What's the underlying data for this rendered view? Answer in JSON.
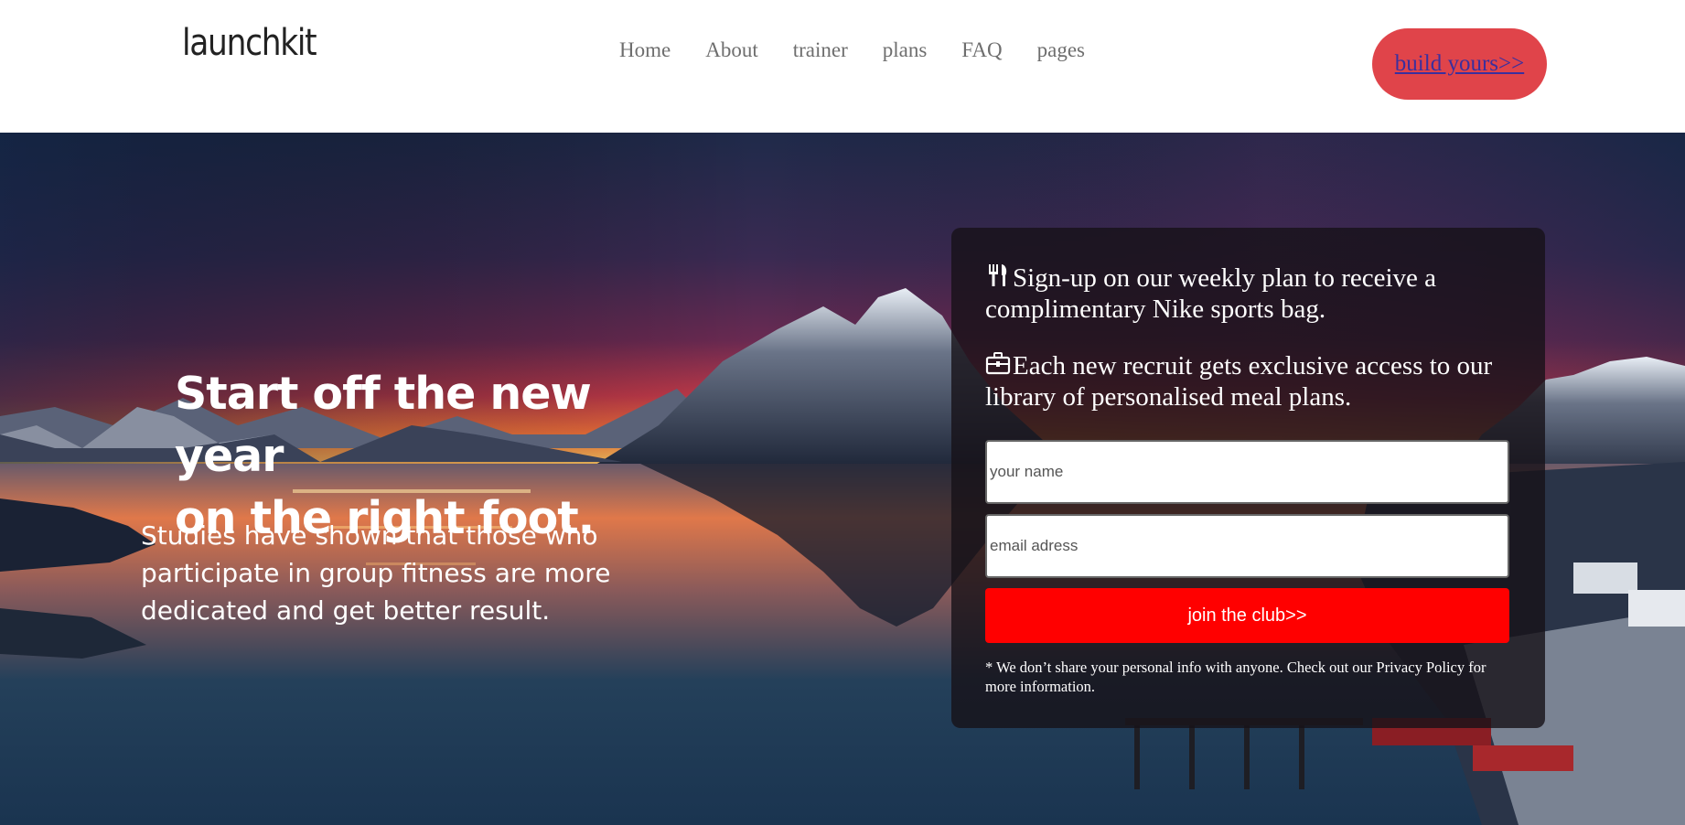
{
  "header": {
    "logo": "launchkit",
    "nav": [
      "Home",
      "About",
      "trainer",
      "plans",
      "FAQ",
      "pages"
    ],
    "cta_label": "build yours>>"
  },
  "hero": {
    "headline_line1": "Start off the new year",
    "headline_line2": "on the right foot.",
    "subtext": "Studies have shown that those who participate in group fitness are more dedicated and get better result."
  },
  "signup": {
    "perk1": "Sign-up on our weekly plan to receive a complimentary Nike sports bag.",
    "perk1_icon": "utensils-icon",
    "perk2": "Each new recruit gets exclusive access to our library of personalised meal plans.",
    "perk2_icon": "briefcase-icon",
    "name_placeholder": "your name",
    "email_placeholder": "email adress",
    "button_label": "join the club>>",
    "disclaimer": "* We don’t share your personal info with anyone. Check out our Privacy Policy for more information."
  },
  "colors": {
    "cta_bg": "#e0444a",
    "cta_text": "#3a2f9e",
    "join_button": "#ff0000"
  }
}
